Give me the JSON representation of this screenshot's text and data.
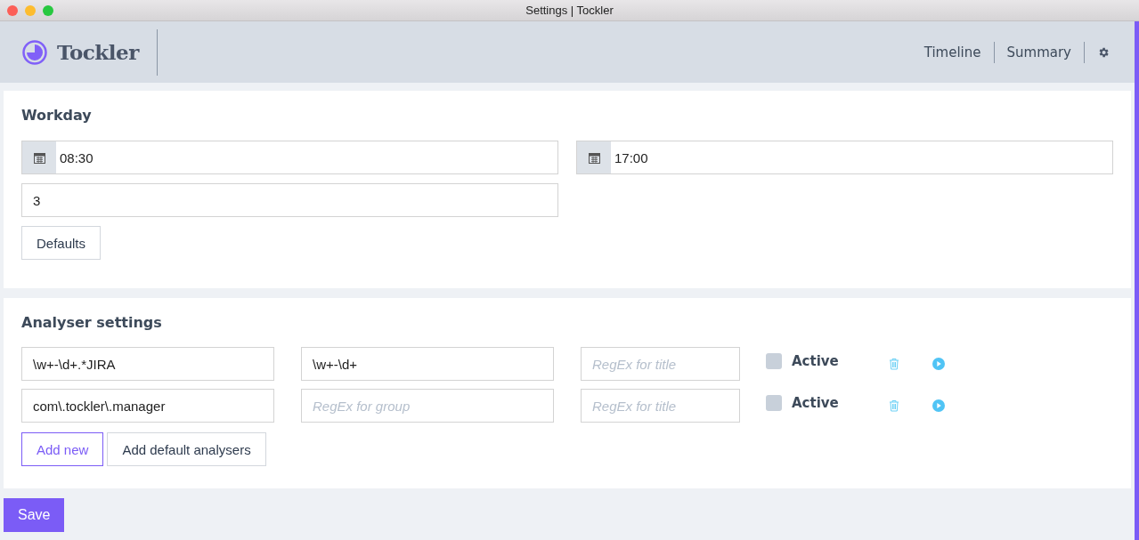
{
  "window": {
    "title": "Settings | Tockler"
  },
  "header": {
    "logo": "Tockler",
    "nav": [
      {
        "label": "Timeline"
      },
      {
        "label": "Summary"
      }
    ]
  },
  "workday": {
    "title": "Workday",
    "start": "08:30",
    "end": "17:00",
    "hours": "3",
    "defaults_button": "Defaults"
  },
  "analyser": {
    "title": "Analyser settings",
    "rows": [
      {
        "find": "\\w+-\\d+.*JIRA",
        "group": "\\w+-\\d+",
        "title_placeholder": "RegEx for title",
        "active": false,
        "active_label": "Active"
      },
      {
        "find": "com\\.tockler\\.manager",
        "group_placeholder": "RegEx for group",
        "title_placeholder": "RegEx for title",
        "active": false,
        "active_label": "Active"
      }
    ],
    "add_button": "Add new",
    "defaults_button": "Add default analysers"
  },
  "save_button": "Save"
}
